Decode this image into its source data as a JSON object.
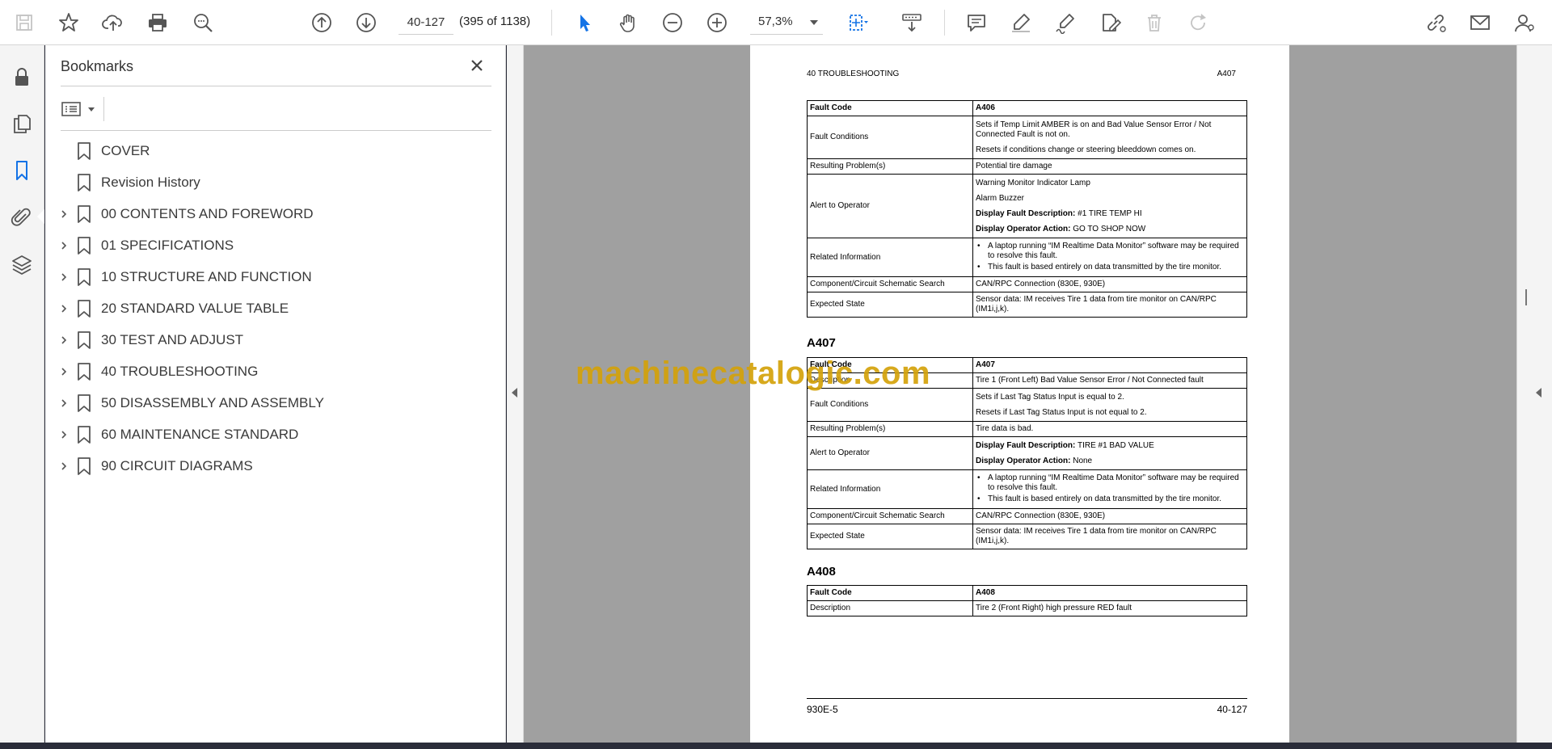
{
  "toolbar": {
    "page_input": "40-127",
    "page_count": "(395 of 1138)",
    "zoom": "57,3%"
  },
  "bookmarks": {
    "title": "Bookmarks",
    "items": [
      {
        "label": "COVER",
        "expandable": false
      },
      {
        "label": "Revision History",
        "expandable": false
      },
      {
        "label": "00 CONTENTS AND FOREWORD",
        "expandable": true
      },
      {
        "label": "01 SPECIFICATIONS",
        "expandable": true
      },
      {
        "label": "10 STRUCTURE AND FUNCTION",
        "expandable": true
      },
      {
        "label": "20 STANDARD VALUE TABLE",
        "expandable": true
      },
      {
        "label": "30 TEST AND ADJUST",
        "expandable": true
      },
      {
        "label": "40 TROUBLESHOOTING",
        "expandable": true
      },
      {
        "label": "50 DISASSEMBLY AND ASSEMBLY",
        "expandable": true
      },
      {
        "label": "60 MAINTENANCE STANDARD",
        "expandable": true
      },
      {
        "label": "90 CIRCUIT DIAGRAMS",
        "expandable": true
      }
    ]
  },
  "document": {
    "header_left": "40 TROUBLESHOOTING",
    "header_right": "A407",
    "footer_left": "930E-5",
    "footer_right": "40-127",
    "watermark": "machinecatalogic.com",
    "a406": {
      "fault_code_label": "Fault Code",
      "fault_code": "A406",
      "conditions_label": "Fault Conditions",
      "conditions_1": "Sets if Temp Limit AMBER is on and Bad Value Sensor Error / Not Connected Fault is not on.",
      "conditions_2": "Resets if conditions change or steering bleeddown comes on.",
      "problem_label": "Resulting Problem(s)",
      "problem": "Potential tire damage",
      "alert_label": "Alert to Operator",
      "alert_1": "Warning Monitor Indicator Lamp",
      "alert_2": "Alarm Buzzer",
      "alert_desc_label": "Display Fault Description:",
      "alert_desc": " #1 TIRE TEMP HI",
      "alert_action_label": "Display Operator Action:",
      "alert_action": " GO TO SHOP NOW",
      "related_label": "Related Information",
      "related_1": "A laptop running “IM Realtime Data Monitor” software may be required to resolve this fault.",
      "related_2": "This fault is based entirely on data transmitted by the tire monitor.",
      "component_label": "Component/Circuit Schematic Search",
      "component": "CAN/RPC Connection (830E, 930E)",
      "expected_label": "Expected State",
      "expected": "Sensor data: IM receives Tire 1 data from tire monitor on CAN/RPC (IM1i,j,k)."
    },
    "a407": {
      "title": "A407",
      "fault_code_label": "Fault Code",
      "fault_code": "A407",
      "description_label": "Description",
      "description": "Tire 1 (Front Left) Bad Value Sensor Error / Not Connected fault",
      "conditions_label": "Fault Conditions",
      "conditions_1": "Sets if Last Tag Status Input is equal to 2.",
      "conditions_2": "Resets if Last Tag Status Input is not equal to 2.",
      "problem_label": "Resulting Problem(s)",
      "problem": "Tire data is bad.",
      "alert_label": "Alert to Operator",
      "alert_desc_label": "Display Fault Description:",
      "alert_desc": " TIRE #1 BAD VALUE",
      "alert_action_label": "Display Operator Action:",
      "alert_action": " None",
      "related_label": "Related Information",
      "related_1": "A laptop running “IM Realtime Data Monitor” software may be required to resolve this fault.",
      "related_2": "This fault is based entirely on data transmitted by the tire monitor.",
      "component_label": "Component/Circuit Schematic Search",
      "component": "CAN/RPC Connection (830E, 930E)",
      "expected_label": "Expected State",
      "expected": "Sensor data: IM receives Tire 1 data from tire monitor on CAN/RPC (IM1i,j,k)."
    },
    "a408": {
      "title": "A408",
      "fault_code_label": "Fault Code",
      "fault_code": "A408",
      "description_label": "Description",
      "description": "Tire 2 (Front Right) high pressure RED fault"
    }
  },
  "colors": {
    "accent": "#1473e6",
    "watermark": "#d4a20a",
    "doc_bg": "#a0a0a0"
  }
}
